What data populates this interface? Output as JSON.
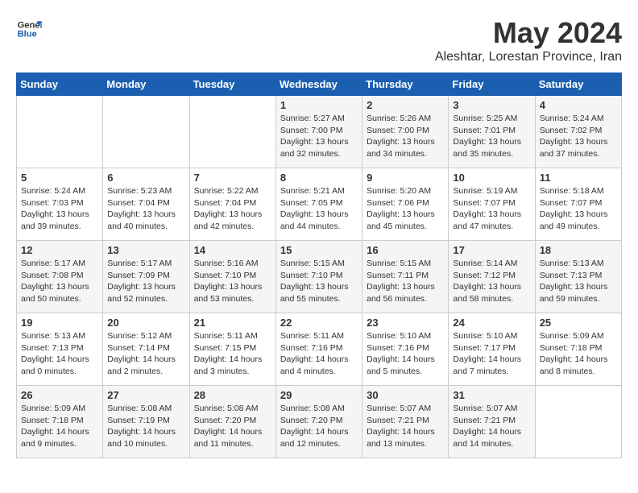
{
  "header": {
    "logo_general": "General",
    "logo_blue": "Blue",
    "month": "May 2024",
    "location": "Aleshtar, Lorestan Province, Iran"
  },
  "weekdays": [
    "Sunday",
    "Monday",
    "Tuesday",
    "Wednesday",
    "Thursday",
    "Friday",
    "Saturday"
  ],
  "weeks": [
    [
      {
        "day": "",
        "info": ""
      },
      {
        "day": "",
        "info": ""
      },
      {
        "day": "",
        "info": ""
      },
      {
        "day": "1",
        "info": "Sunrise: 5:27 AM\nSunset: 7:00 PM\nDaylight: 13 hours\nand 32 minutes."
      },
      {
        "day": "2",
        "info": "Sunrise: 5:26 AM\nSunset: 7:00 PM\nDaylight: 13 hours\nand 34 minutes."
      },
      {
        "day": "3",
        "info": "Sunrise: 5:25 AM\nSunset: 7:01 PM\nDaylight: 13 hours\nand 35 minutes."
      },
      {
        "day": "4",
        "info": "Sunrise: 5:24 AM\nSunset: 7:02 PM\nDaylight: 13 hours\nand 37 minutes."
      }
    ],
    [
      {
        "day": "5",
        "info": "Sunrise: 5:24 AM\nSunset: 7:03 PM\nDaylight: 13 hours\nand 39 minutes."
      },
      {
        "day": "6",
        "info": "Sunrise: 5:23 AM\nSunset: 7:04 PM\nDaylight: 13 hours\nand 40 minutes."
      },
      {
        "day": "7",
        "info": "Sunrise: 5:22 AM\nSunset: 7:04 PM\nDaylight: 13 hours\nand 42 minutes."
      },
      {
        "day": "8",
        "info": "Sunrise: 5:21 AM\nSunset: 7:05 PM\nDaylight: 13 hours\nand 44 minutes."
      },
      {
        "day": "9",
        "info": "Sunrise: 5:20 AM\nSunset: 7:06 PM\nDaylight: 13 hours\nand 45 minutes."
      },
      {
        "day": "10",
        "info": "Sunrise: 5:19 AM\nSunset: 7:07 PM\nDaylight: 13 hours\nand 47 minutes."
      },
      {
        "day": "11",
        "info": "Sunrise: 5:18 AM\nSunset: 7:07 PM\nDaylight: 13 hours\nand 49 minutes."
      }
    ],
    [
      {
        "day": "12",
        "info": "Sunrise: 5:17 AM\nSunset: 7:08 PM\nDaylight: 13 hours\nand 50 minutes."
      },
      {
        "day": "13",
        "info": "Sunrise: 5:17 AM\nSunset: 7:09 PM\nDaylight: 13 hours\nand 52 minutes."
      },
      {
        "day": "14",
        "info": "Sunrise: 5:16 AM\nSunset: 7:10 PM\nDaylight: 13 hours\nand 53 minutes."
      },
      {
        "day": "15",
        "info": "Sunrise: 5:15 AM\nSunset: 7:10 PM\nDaylight: 13 hours\nand 55 minutes."
      },
      {
        "day": "16",
        "info": "Sunrise: 5:15 AM\nSunset: 7:11 PM\nDaylight: 13 hours\nand 56 minutes."
      },
      {
        "day": "17",
        "info": "Sunrise: 5:14 AM\nSunset: 7:12 PM\nDaylight: 13 hours\nand 58 minutes."
      },
      {
        "day": "18",
        "info": "Sunrise: 5:13 AM\nSunset: 7:13 PM\nDaylight: 13 hours\nand 59 minutes."
      }
    ],
    [
      {
        "day": "19",
        "info": "Sunrise: 5:13 AM\nSunset: 7:13 PM\nDaylight: 14 hours\nand 0 minutes."
      },
      {
        "day": "20",
        "info": "Sunrise: 5:12 AM\nSunset: 7:14 PM\nDaylight: 14 hours\nand 2 minutes."
      },
      {
        "day": "21",
        "info": "Sunrise: 5:11 AM\nSunset: 7:15 PM\nDaylight: 14 hours\nand 3 minutes."
      },
      {
        "day": "22",
        "info": "Sunrise: 5:11 AM\nSunset: 7:16 PM\nDaylight: 14 hours\nand 4 minutes."
      },
      {
        "day": "23",
        "info": "Sunrise: 5:10 AM\nSunset: 7:16 PM\nDaylight: 14 hours\nand 5 minutes."
      },
      {
        "day": "24",
        "info": "Sunrise: 5:10 AM\nSunset: 7:17 PM\nDaylight: 14 hours\nand 7 minutes."
      },
      {
        "day": "25",
        "info": "Sunrise: 5:09 AM\nSunset: 7:18 PM\nDaylight: 14 hours\nand 8 minutes."
      }
    ],
    [
      {
        "day": "26",
        "info": "Sunrise: 5:09 AM\nSunset: 7:18 PM\nDaylight: 14 hours\nand 9 minutes."
      },
      {
        "day": "27",
        "info": "Sunrise: 5:08 AM\nSunset: 7:19 PM\nDaylight: 14 hours\nand 10 minutes."
      },
      {
        "day": "28",
        "info": "Sunrise: 5:08 AM\nSunset: 7:20 PM\nDaylight: 14 hours\nand 11 minutes."
      },
      {
        "day": "29",
        "info": "Sunrise: 5:08 AM\nSunset: 7:20 PM\nDaylight: 14 hours\nand 12 minutes."
      },
      {
        "day": "30",
        "info": "Sunrise: 5:07 AM\nSunset: 7:21 PM\nDaylight: 14 hours\nand 13 minutes."
      },
      {
        "day": "31",
        "info": "Sunrise: 5:07 AM\nSunset: 7:21 PM\nDaylight: 14 hours\nand 14 minutes."
      },
      {
        "day": "",
        "info": ""
      }
    ]
  ]
}
